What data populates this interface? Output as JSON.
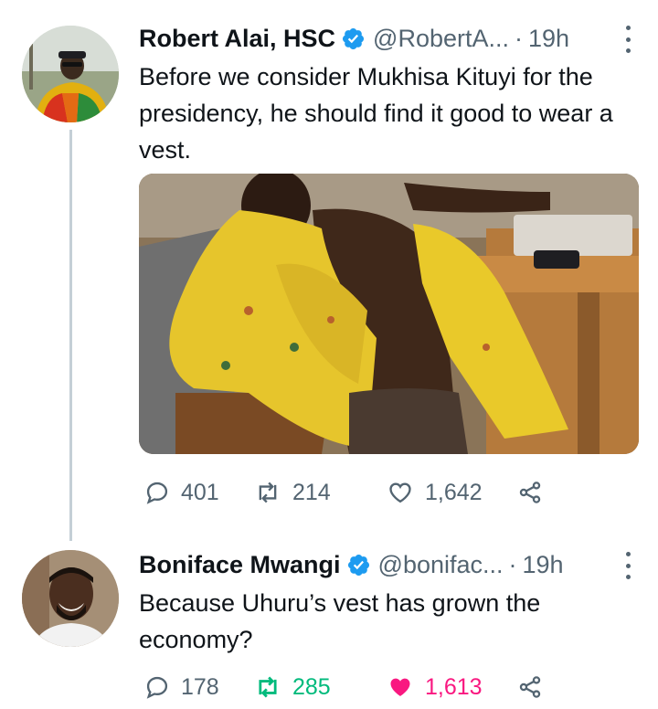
{
  "tweets": [
    {
      "author_name": "Robert Alai, HSC",
      "handle": "@RobertA...",
      "separator": "·",
      "time": "19h",
      "text": "Before we consider Mukhisa Kituyi for the presidency, he should find it good to wear a vest.",
      "has_media": true,
      "stats": {
        "replies": "401",
        "retweets": "214",
        "likes": "1,642"
      },
      "retweeted": false,
      "liked": false
    },
    {
      "author_name": "Boniface Mwangi",
      "handle": "@bonifac...",
      "separator": "·",
      "time": "19h",
      "text": "Because Uhuru’s vest has grown the economy?",
      "has_media": false,
      "stats": {
        "replies": "178",
        "retweets": "285",
        "likes": "1,613"
      },
      "retweeted": true,
      "liked": true
    }
  ],
  "icons": {
    "verified": "verified-badge-icon",
    "more": "more-options-icon",
    "reply": "reply-icon",
    "retweet": "retweet-icon",
    "like": "heart-icon",
    "share": "share-icon"
  },
  "colors": {
    "verified": "#1d9bf0",
    "secondary_text": "#536471",
    "retweet_active": "#00ba7c",
    "like_active": "#f91880",
    "thread_line": "#c4cfd6"
  }
}
